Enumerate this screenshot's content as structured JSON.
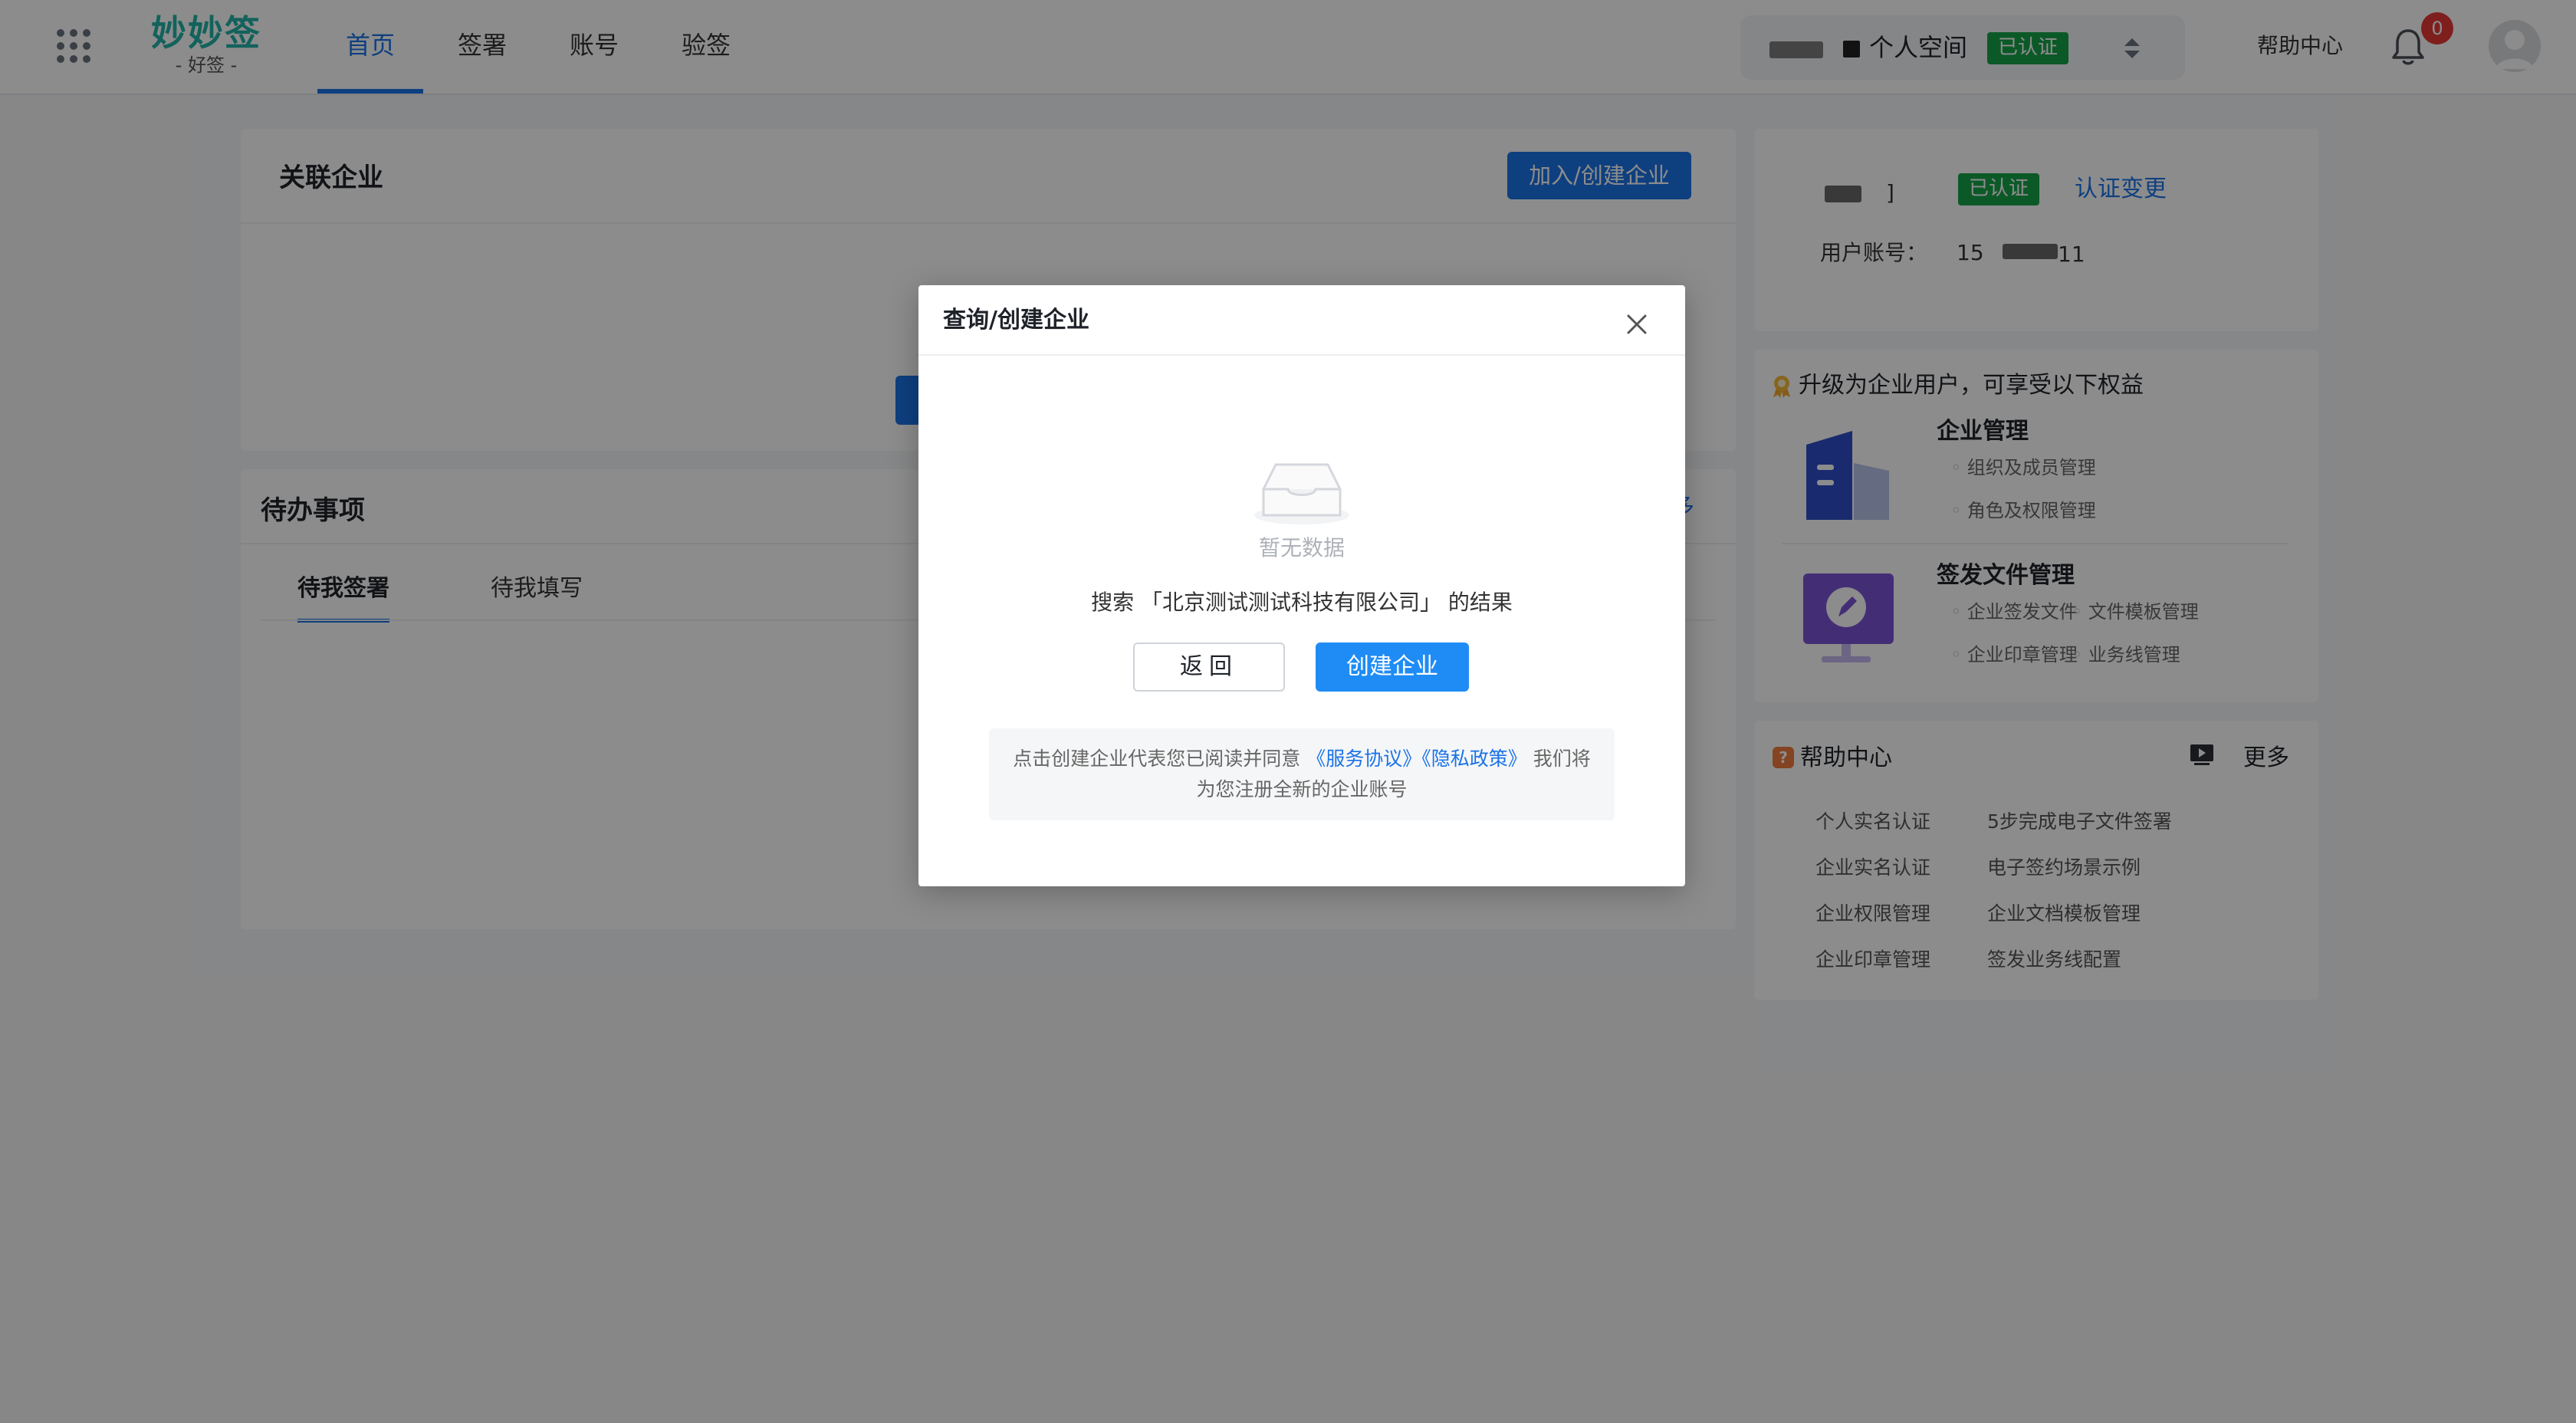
{
  "header": {
    "logo_main": "妙妙签",
    "logo_sub": "-   好签   -",
    "nav": [
      {
        "label": "首页",
        "active": true
      },
      {
        "label": "签署",
        "active": false
      },
      {
        "label": "账号",
        "active": false
      },
      {
        "label": "验签",
        "active": false
      }
    ],
    "space_name": "个人空间",
    "space_badge": "已认证",
    "help_center": "帮助中心",
    "notification_count": "0"
  },
  "linked": {
    "title": "关联企业",
    "join_button": "加入/创建企业"
  },
  "todo": {
    "title": "待办事项",
    "more_partial": "多",
    "tabs": [
      "待我签署",
      "待我填写"
    ]
  },
  "user": {
    "name_tail": "‌]",
    "badge": "已认证",
    "change_link": "认证变更",
    "account_label": "用户账号：",
    "account_part1": "15",
    "account_part2": "11"
  },
  "upgrade": {
    "title": "升级为企业用户，可享受以下权益",
    "features": [
      {
        "title": "企业管理",
        "items": [
          "组织及成员管理",
          "角色及权限管理"
        ]
      },
      {
        "title": "签发文件管理",
        "items": [
          "企业签发文件",
          "文件模板管理",
          "企业印章管理",
          "业务线管理"
        ]
      }
    ]
  },
  "help": {
    "title": "帮助中心",
    "more": "更多",
    "items": [
      "个人实名认证",
      "5步完成电子文件签署",
      "企业实名认证",
      "电子签约场景示例",
      "企业权限管理",
      "企业文档模板管理",
      "企业印章管理",
      "签发业务线配置"
    ]
  },
  "modal": {
    "title": "查询/创建企业",
    "empty_text": "暂无数据",
    "search_result": "搜索 「北京测试测试科技有限公司」 的结果",
    "back_button": "返回",
    "create_button": "创建企业",
    "notice_prefix": "点击创建企业代表您已阅读并同意",
    "service_agreement": "《服务协议》",
    "privacy_policy": "《隐私政策》",
    "notice_suffix": "我们将为您注册全新的企业账号"
  },
  "colors": {
    "primary": "#1a73e8",
    "logo": "#24b3a8",
    "verified": "#16a34a",
    "notification": "#e53935"
  }
}
